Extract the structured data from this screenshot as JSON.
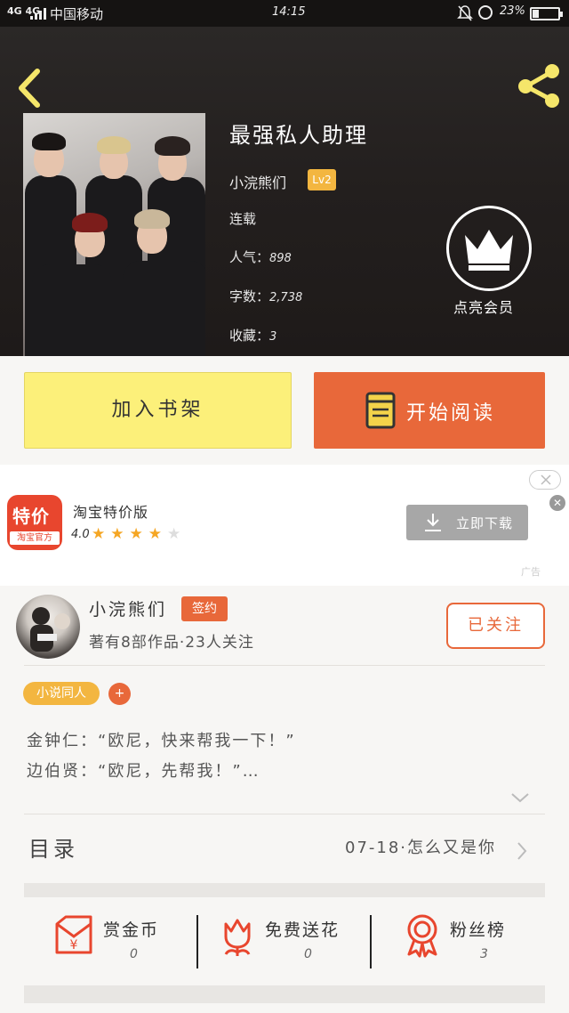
{
  "status_bar": {
    "network": "4G 4G",
    "carrier": "中国移动",
    "time": "14:15",
    "battery": "23%"
  },
  "book": {
    "title": "最强私人助理",
    "author": "小浣熊们",
    "level": "Lv2",
    "status": "连载",
    "popularity_label": "人气：",
    "popularity": "898",
    "word_count_label": "字数：",
    "word_count": "2,738",
    "favorites_label": "收藏：",
    "favorites": "3"
  },
  "vip": {
    "label": "点亮会员"
  },
  "actions": {
    "add_shelf": "加入书架",
    "start_reading": "开始阅读"
  },
  "ad": {
    "logo_top": "特价",
    "logo_bottom": "淘宝官方",
    "app_name": "淘宝特价版",
    "rating": "4.0",
    "stars_filled": 4,
    "stars_total": 5,
    "download": "立即下载",
    "tag": "广告"
  },
  "author_card": {
    "name": "小浣熊们",
    "badge": "签约",
    "stats": "著有8部作品·23人关注",
    "follow": "已关注"
  },
  "tags": {
    "tag": "小说同人",
    "add": "+"
  },
  "description": {
    "line1": "金钟仁：“欧尼，快来帮我一下！”",
    "line2": "边伯贤：“欧尼，先帮我！”…"
  },
  "toc": {
    "title": "目录",
    "latest": "07-18·怎么又是你"
  },
  "stats": [
    {
      "name": "赏金币",
      "value": "0",
      "icon": "red-envelope-icon"
    },
    {
      "name": "免费送花",
      "value": "0",
      "icon": "flower-icon"
    },
    {
      "name": "粉丝榜",
      "value": "3",
      "icon": "medal-icon"
    }
  ],
  "colors": {
    "accent_orange": "#e8683a",
    "badge_yellow": "#f3b640",
    "shelf_yellow": "#fcf07a",
    "back_arrow": "#f5e66a"
  }
}
